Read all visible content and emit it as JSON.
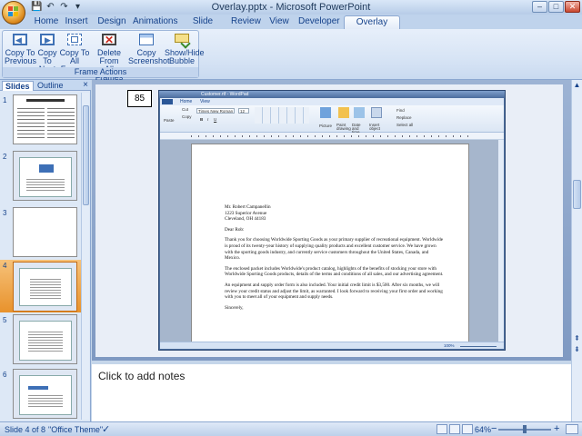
{
  "window": {
    "title": "Overlay.pptx - Microsoft PowerPoint",
    "minimize": "–",
    "maximize": "□",
    "close": "✕"
  },
  "quick_access": [
    "💾",
    "↶",
    "↷",
    "▾"
  ],
  "tabs": [
    {
      "label": "Home"
    },
    {
      "label": "Insert"
    },
    {
      "label": "Design"
    },
    {
      "label": "Animations"
    },
    {
      "label": "Slide Show"
    },
    {
      "label": "Review"
    },
    {
      "label": "View"
    },
    {
      "label": "Developer"
    },
    {
      "label": "Overlay Editor",
      "active": true
    }
  ],
  "ribbon": {
    "group_label": "Frame Actions",
    "buttons": [
      {
        "line1": "Copy To",
        "line2": "Previous",
        "icon": "copy-to-previous-icon"
      },
      {
        "line1": "Copy",
        "line2": "To Next",
        "icon": "copy-to-next-icon"
      },
      {
        "line1": "Copy To",
        "line2": "All Frames",
        "icon": "copy-to-all-frames-icon"
      },
      {
        "line1": "Delete From",
        "line2": "All Frames",
        "icon": "delete-from-all-frames-icon"
      },
      {
        "line1": "Copy",
        "line2": "Screenshot",
        "icon": "copy-screenshot-icon"
      },
      {
        "line1": "Show/Hide",
        "line2": "Bubble",
        "icon": "show-hide-bubble-icon"
      }
    ]
  },
  "left_pane": {
    "tabs": [
      {
        "label": "Slides",
        "active": true
      },
      {
        "label": "Outline"
      }
    ],
    "close": "×",
    "slides": [
      {
        "num": "1"
      },
      {
        "num": "2"
      },
      {
        "num": "3"
      },
      {
        "num": "4",
        "selected": true
      },
      {
        "num": "5"
      },
      {
        "num": "6"
      }
    ]
  },
  "slide": {
    "number_box": "85"
  },
  "wordpad": {
    "title": "Customer.rtf - WordPad",
    "tabs": [
      "Home",
      "View"
    ],
    "ribbon_labels": [
      "Paste",
      "Cut",
      "Copy",
      "Times New Roman",
      "12",
      "Picture",
      "Paint drawing",
      "Date and time",
      "Insert object",
      "Find",
      "Replace",
      "Select all"
    ],
    "group_labels": [
      "Clipboard",
      "Font",
      "Paragraph",
      "Insert",
      "Editing"
    ],
    "letter": {
      "address1": "Mr. Robert Campanellin",
      "address2": "1223 Superior Avenue",
      "address3": "Cleveland, OH  44183",
      "greeting": "Dear Rob:",
      "para1": "Thank you for choosing Worldwide Sporting Goods as your primary supplier of recreational equipment. Worldwide is proud of its twenty-year history of supplying quality products and excellent customer service. We have grown with the sporting goods industry, and currently service customers throughout the United States, Canada, and Mexico.",
      "para2": "The enclosed packet includes Worldwide's product catalog, highlights of the benefits of stocking your store with Worldwide Sporting Goods products, details of the terms and conditions of all sales, and our advertising agreement.",
      "para3": "An equipment and supply order form is also included. Your initial credit limit is $3,500. After six months, we will review your credit status and adjust the limit, as warranted. I look forward to receiving your first order and working with you to meet all of your equipment and supply needs.",
      "closing": "Sincerely,"
    },
    "zoom": "100%"
  },
  "notes": {
    "placeholder": "Click to add notes"
  },
  "statusbar": {
    "slide_info": "Slide 4 of 8",
    "theme": "\"Office Theme\"",
    "zoom": "64%"
  }
}
